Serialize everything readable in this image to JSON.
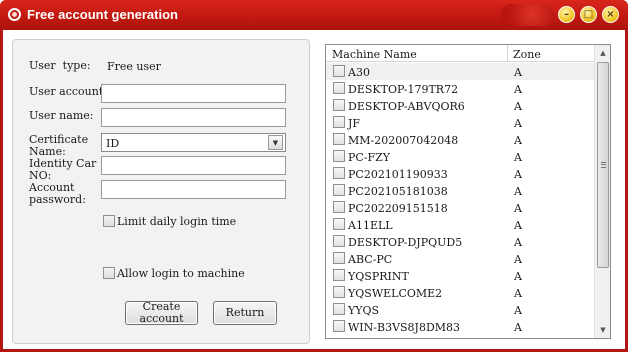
{
  "window": {
    "title": "Free account generation"
  },
  "title_icons": {
    "app": "app-icon",
    "minimize": "minimize-icon",
    "maximize": "maximize-icon",
    "close": "close-icon"
  },
  "title_glyphs": {
    "minimize": "–",
    "maximize": "□",
    "close": "×"
  },
  "form": {
    "user_type_label": "User  type:",
    "user_type_value": "Free user",
    "user_account_label": "User account",
    "user_account_value": "",
    "user_name_label": "User name:",
    "user_name_value": "",
    "certificate_name_label": "Certificate\nName:",
    "certificate_name_value": "ID",
    "identity_label": "Identity Car\nNO:",
    "identity_value": "",
    "account_password_label": "Account\npassword:",
    "account_password_value": "",
    "limit_daily_label": "Limit daily login time",
    "limit_daily_checked": false,
    "allow_login_label": "Allow login to machine",
    "allow_login_checked": false,
    "create_button": "Create\naccount",
    "return_button": "Return"
  },
  "machines": {
    "columns": [
      "Machine Name",
      "Zone"
    ],
    "rows": [
      {
        "name": "A30",
        "zone": "A",
        "checked": false
      },
      {
        "name": "DESKTOP-179TR72",
        "zone": "A",
        "checked": false
      },
      {
        "name": "DESKTOP-ABVQOR6",
        "zone": "A",
        "checked": false
      },
      {
        "name": "JF",
        "zone": "A",
        "checked": false
      },
      {
        "name": "MM-202007042048",
        "zone": "A",
        "checked": false
      },
      {
        "name": "PC-FZY",
        "zone": "A",
        "checked": false
      },
      {
        "name": "PC202101190933",
        "zone": "A",
        "checked": false
      },
      {
        "name": "PC202105181038",
        "zone": "A",
        "checked": false
      },
      {
        "name": "PC202209151518",
        "zone": "A",
        "checked": false
      },
      {
        "name": "A11ELL",
        "zone": "A",
        "checked": false
      },
      {
        "name": "DESKTOP-DJPQUD5",
        "zone": "A",
        "checked": false
      },
      {
        "name": "ABC-PC",
        "zone": "A",
        "checked": false
      },
      {
        "name": "YQSPRINT",
        "zone": "A",
        "checked": false
      },
      {
        "name": "YQSWELCOME2",
        "zone": "A",
        "checked": false
      },
      {
        "name": "YYQS",
        "zone": "A",
        "checked": false
      },
      {
        "name": "WIN-B3VS8J8DM83",
        "zone": "A",
        "checked": false
      }
    ],
    "selected_index": 0
  },
  "scrollbar": {
    "up": "▲",
    "down": "▼",
    "grip": "grip-icon"
  }
}
